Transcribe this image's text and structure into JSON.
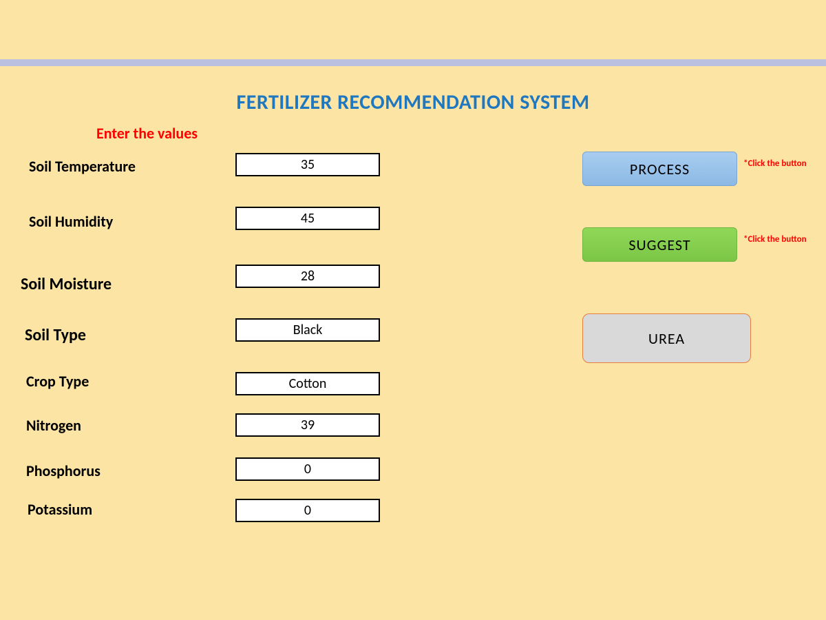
{
  "title": "FERTILIZER RECOMMENDATION SYSTEM",
  "subtitle": "Enter the values",
  "fields": {
    "soil_temperature": {
      "label": "Soil Temperature",
      "value": "35"
    },
    "soil_humidity": {
      "label": "Soil Humidity",
      "value": "45"
    },
    "soil_moisture": {
      "label": "Soil Moisture",
      "value": "28"
    },
    "soil_type": {
      "label": "Soil Type",
      "value": "Black"
    },
    "crop_type": {
      "label": "Crop Type",
      "value": "Cotton"
    },
    "nitrogen": {
      "label": "Nitrogen",
      "value": "39"
    },
    "phosphorus": {
      "label": "Phosphorus",
      "value": "0"
    },
    "potassium": {
      "label": "Potassium",
      "value": "0"
    }
  },
  "buttons": {
    "process": "PROCESS",
    "suggest": "SUGGEST"
  },
  "hints": {
    "process": "*Click the button",
    "suggest": "*Click the button"
  },
  "result": "UREA"
}
